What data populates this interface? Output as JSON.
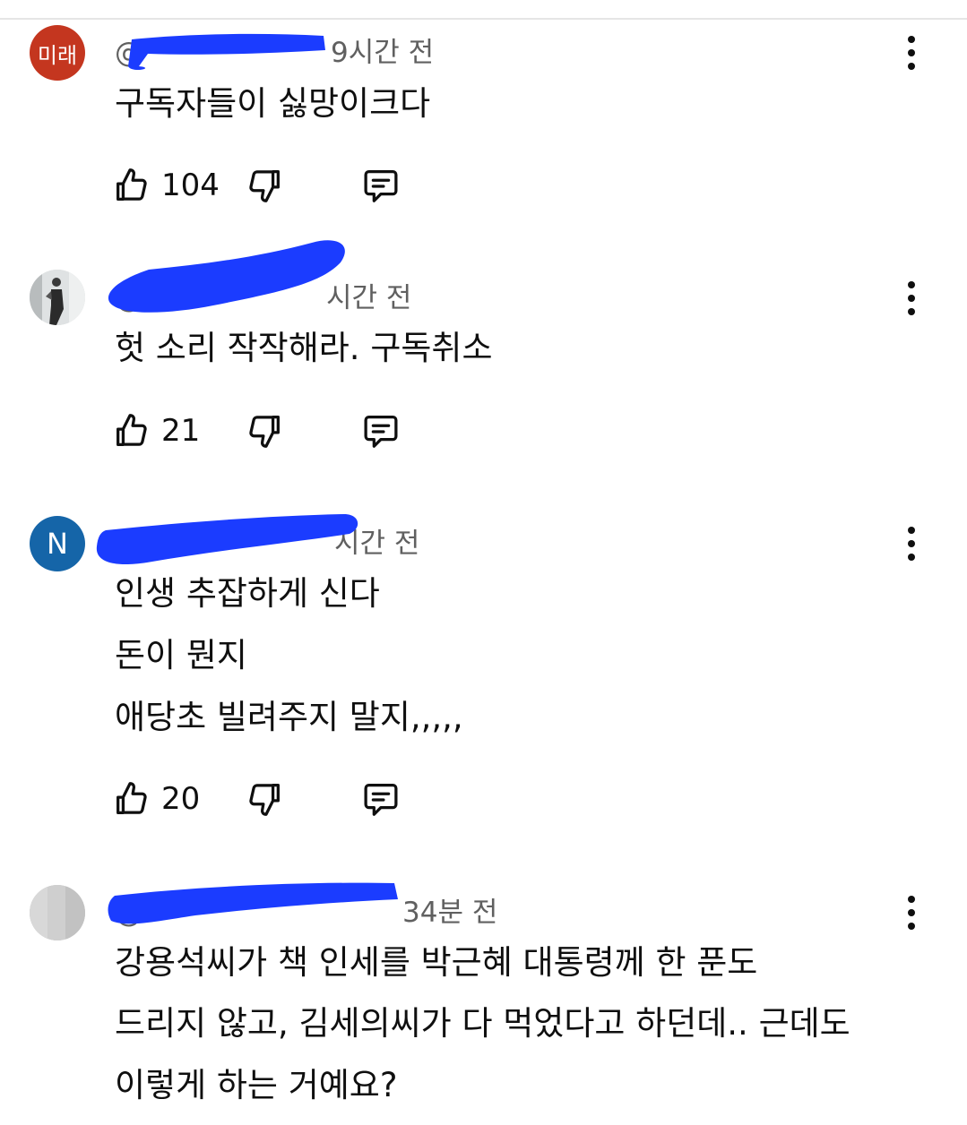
{
  "comments": [
    {
      "avatar_text": "미래",
      "avatar_color": "#c4361f",
      "handle": "@",
      "time": "9시간 전",
      "lines": [
        "구독자들이 싫망이크다"
      ],
      "likes": "104"
    },
    {
      "avatar_text": "",
      "avatar_color": "#8a8f92",
      "handle": "@",
      "time": "시간 전",
      "lines": [
        "헛 소리 작작해라. 구독취소"
      ],
      "likes": "21"
    },
    {
      "avatar_text": "N",
      "avatar_color": "#1565a8",
      "handle": "",
      "time": "시간 전",
      "lines": [
        "인생 추잡하게 신다",
        "돈이 뭔지",
        "애당초 빌려주지 말지,,,,,"
      ],
      "likes": "20"
    },
    {
      "avatar_text": "",
      "avatar_color": "#c9c9c9",
      "handle": "@",
      "time": "34분 전",
      "lines": [
        "강용석씨가 책 인세를 박근혜 대통령께 한 푼도",
        "드리지 않고, 김세의씨가 다 먹었다고 하던데.. 근데도",
        "이렇게 하는 거예요?"
      ],
      "likes": ""
    }
  ],
  "icons": {
    "like": "thumbs-up-icon",
    "dislike": "thumbs-down-icon",
    "reply": "reply-comment-icon",
    "menu": "more-vertical-icon"
  },
  "colors": {
    "redaction": "#1b3cff",
    "meta_text": "#606060",
    "body_text": "#0f0f0f"
  }
}
